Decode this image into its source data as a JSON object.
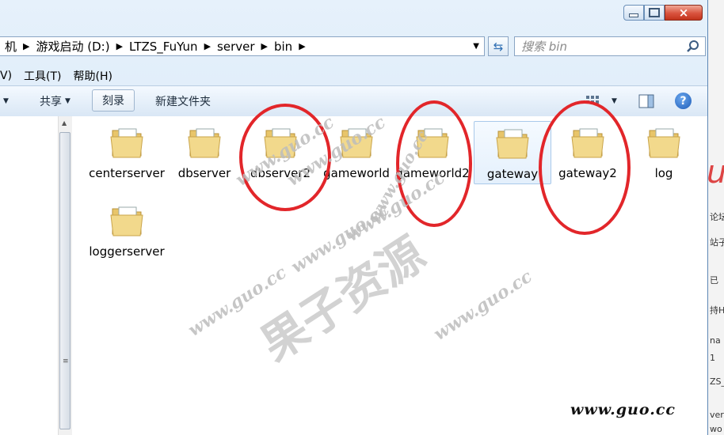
{
  "window": {
    "caption_buttons": {
      "minimize": "minimize",
      "maximize": "maximize",
      "close": "×"
    }
  },
  "address": {
    "crumbs": [
      "机",
      "游戏启动 (D:)",
      "LTZS_FuYun",
      "server",
      "bin"
    ]
  },
  "search": {
    "placeholder": "搜索 bin"
  },
  "menu": {
    "items": [
      "V)",
      "工具(T)",
      "帮助(H)"
    ]
  },
  "toolbar": {
    "share_label": "共享",
    "burn_label": "刻录",
    "new_folder_label": "新建文件夹"
  },
  "folders": [
    {
      "name": "centerserver"
    },
    {
      "name": "dbserver"
    },
    {
      "name": "dbserver2"
    },
    {
      "name": "gameworld"
    },
    {
      "name": "gameworld2"
    },
    {
      "name": "gateway"
    },
    {
      "name": "gateway2"
    },
    {
      "name": "log"
    },
    {
      "name": "loggerserver"
    }
  ],
  "watermark": {
    "cn": "果子资源",
    "repeat": "www.guo.cc",
    "corner": "www.guo.cc"
  },
  "background_window": {
    "snippets": [
      "u",
      "论坛",
      "站子",
      "已",
      "持H",
      "na",
      "1",
      "ZS_",
      "ver",
      "wo"
    ]
  },
  "colors": {
    "accent_circle": "#e2262a",
    "desktop": "#3aa84a",
    "watermark_text": "#bdbdbd"
  }
}
